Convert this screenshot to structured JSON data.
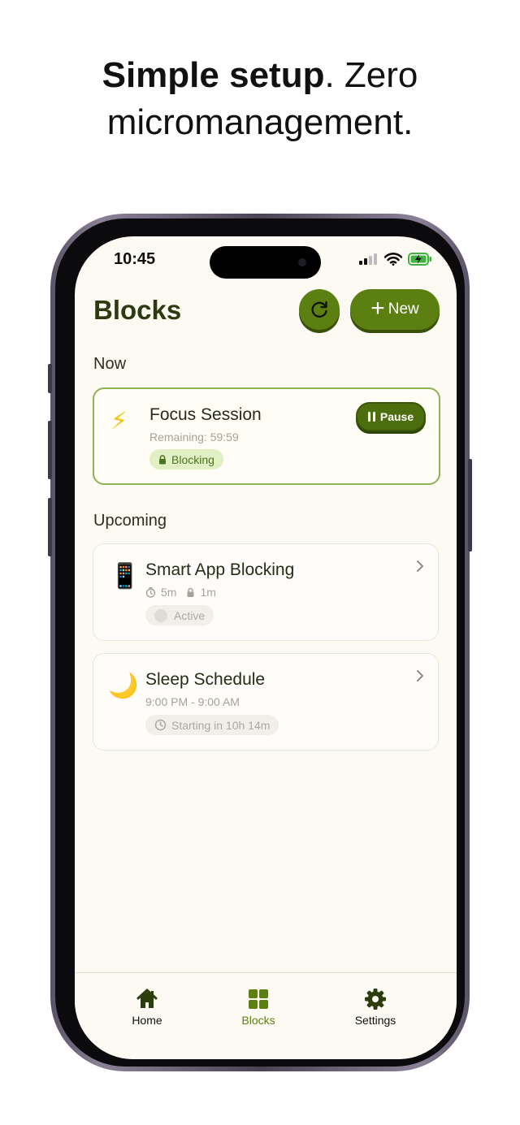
{
  "headline": {
    "bold": "Simple setup",
    "rest": ". Zero micromanagement."
  },
  "status_bar": {
    "time": "10:45"
  },
  "header": {
    "title": "Blocks",
    "new_label": "New"
  },
  "sections": {
    "now": "Now",
    "upcoming": "Upcoming"
  },
  "active_block": {
    "icon": "⚡",
    "title": "Focus Session",
    "remaining": "Remaining: 59:59",
    "badge": "Blocking",
    "pause_label": "Pause"
  },
  "upcoming_blocks": [
    {
      "icon": "📱",
      "title": "Smart App Blocking",
      "meta_1": "5m",
      "meta_2": "1m",
      "badge": "Active"
    },
    {
      "icon": "🌙",
      "title": "Sleep Schedule",
      "subtitle": "9:00 PM - 9:00 AM",
      "badge": "Starting in 10h 14m"
    }
  ],
  "tabs": [
    {
      "label": "Home",
      "icon": "home-icon"
    },
    {
      "label": "Blocks",
      "icon": "grid-icon",
      "selected": true
    },
    {
      "label": "Settings",
      "icon": "gear-icon"
    }
  ],
  "colors": {
    "accent": "#5c7f12",
    "accent_dark": "#38500a",
    "screen_bg": "#fdfaf3",
    "badge_green_bg": "#e1f0c5"
  }
}
